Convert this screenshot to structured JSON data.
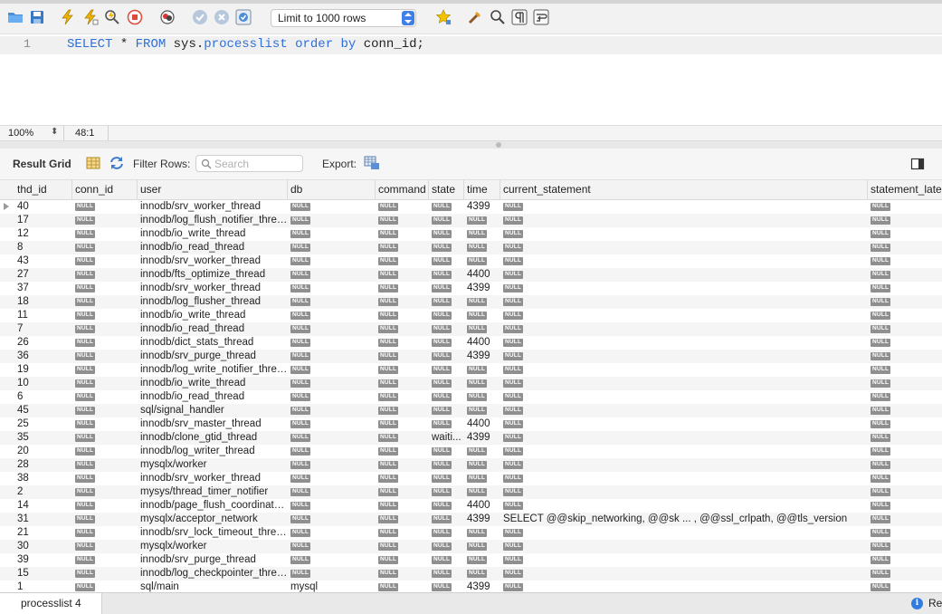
{
  "toolbar": {
    "limit_select": "Limit to 1000 rows",
    "icons": [
      "open-folder-icon",
      "save-icon",
      "execute-icon",
      "execute-current-icon",
      "explain-icon",
      "stop-icon",
      "toggle-error-icon",
      "commit-icon",
      "rollback-icon",
      "autocommit-icon",
      "bookmark-star-icon",
      "beautify-icon",
      "find-icon",
      "invisible-chars-icon",
      "word-wrap-icon"
    ]
  },
  "editor": {
    "line_number": "1",
    "tokens": [
      {
        "text": "SELECT",
        "kind": "kw"
      },
      {
        "text": " * ",
        "kind": "id"
      },
      {
        "text": "FROM",
        "kind": "kw"
      },
      {
        "text": " sys.",
        "kind": "id"
      },
      {
        "text": "processlist",
        "kind": "kw"
      },
      {
        "text": " ",
        "kind": "id"
      },
      {
        "text": "order",
        "kind": "kw"
      },
      {
        "text": " ",
        "kind": "id"
      },
      {
        "text": "by",
        "kind": "kw"
      },
      {
        "text": " conn_id;",
        "kind": "id"
      }
    ]
  },
  "statusbar": {
    "zoom": "100%",
    "cursor_position": "48:1"
  },
  "result_bar": {
    "title": "Result Grid",
    "filter_label": "Filter Rows:",
    "search_placeholder": "Search",
    "export_label": "Export:"
  },
  "grid": {
    "columns": [
      "thd_id",
      "conn_id",
      "user",
      "db",
      "command",
      "state",
      "time",
      "current_statement",
      "statement_late"
    ],
    "null_text": "NULL",
    "rows": [
      [
        "40",
        null,
        "innodb/srv_worker_thread",
        null,
        null,
        null,
        "4399",
        null,
        null
      ],
      [
        "17",
        null,
        "innodb/log_flush_notifier_thread",
        null,
        null,
        null,
        null,
        null,
        null
      ],
      [
        "12",
        null,
        "innodb/io_write_thread",
        null,
        null,
        null,
        null,
        null,
        null
      ],
      [
        "8",
        null,
        "innodb/io_read_thread",
        null,
        null,
        null,
        null,
        null,
        null
      ],
      [
        "43",
        null,
        "innodb/srv_worker_thread",
        null,
        null,
        null,
        null,
        null,
        null
      ],
      [
        "27",
        null,
        "innodb/fts_optimize_thread",
        null,
        null,
        null,
        "4400",
        null,
        null
      ],
      [
        "37",
        null,
        "innodb/srv_worker_thread",
        null,
        null,
        null,
        "4399",
        null,
        null
      ],
      [
        "18",
        null,
        "innodb/log_flusher_thread",
        null,
        null,
        null,
        null,
        null,
        null
      ],
      [
        "11",
        null,
        "innodb/io_write_thread",
        null,
        null,
        null,
        null,
        null,
        null
      ],
      [
        "7",
        null,
        "innodb/io_read_thread",
        null,
        null,
        null,
        null,
        null,
        null
      ],
      [
        "26",
        null,
        "innodb/dict_stats_thread",
        null,
        null,
        null,
        "4400",
        null,
        null
      ],
      [
        "36",
        null,
        "innodb/srv_purge_thread",
        null,
        null,
        null,
        "4399",
        null,
        null
      ],
      [
        "19",
        null,
        "innodb/log_write_notifier_thread",
        null,
        null,
        null,
        null,
        null,
        null
      ],
      [
        "10",
        null,
        "innodb/io_write_thread",
        null,
        null,
        null,
        null,
        null,
        null
      ],
      [
        "6",
        null,
        "innodb/io_read_thread",
        null,
        null,
        null,
        null,
        null,
        null
      ],
      [
        "45",
        null,
        "sql/signal_handler",
        null,
        null,
        null,
        null,
        null,
        null
      ],
      [
        "25",
        null,
        "innodb/srv_master_thread",
        null,
        null,
        null,
        "4400",
        null,
        null
      ],
      [
        "35",
        null,
        "innodb/clone_gtid_thread",
        null,
        null,
        "waiti...",
        "4399",
        null,
        null
      ],
      [
        "20",
        null,
        "innodb/log_writer_thread",
        null,
        null,
        null,
        null,
        null,
        null
      ],
      [
        "28",
        null,
        "mysqlx/worker",
        null,
        null,
        null,
        null,
        null,
        null
      ],
      [
        "38",
        null,
        "innodb/srv_worker_thread",
        null,
        null,
        null,
        null,
        null,
        null
      ],
      [
        "2",
        null,
        "mysys/thread_timer_notifier",
        null,
        null,
        null,
        null,
        null,
        null
      ],
      [
        "14",
        null,
        "innodb/page_flush_coordinato...",
        null,
        null,
        null,
        "4400",
        null,
        null
      ],
      [
        "31",
        null,
        "mysqlx/acceptor_network",
        null,
        null,
        null,
        "4399",
        "SELECT @@skip_networking, @@sk ... , @@ssl_crlpath, @@tls_version",
        null
      ],
      [
        "21",
        null,
        "innodb/srv_lock_timeout_thread",
        null,
        null,
        null,
        null,
        null,
        null
      ],
      [
        "30",
        null,
        "mysqlx/worker",
        null,
        null,
        null,
        null,
        null,
        null
      ],
      [
        "39",
        null,
        "innodb/srv_purge_thread",
        null,
        null,
        null,
        null,
        null,
        null
      ],
      [
        "15",
        null,
        "innodb/log_checkpointer_thread",
        null,
        null,
        null,
        null,
        null,
        null
      ],
      [
        "1",
        null,
        "sql/main",
        "mysql",
        null,
        null,
        "4399",
        null,
        null
      ]
    ]
  },
  "tabbar": {
    "tab_label": "processlist 4",
    "right_text": "Re"
  },
  "colors": {
    "keyword": "#2d6fd8",
    "select_arrows": "#3f7fe8",
    "null_badge": "#8f8f8f"
  }
}
